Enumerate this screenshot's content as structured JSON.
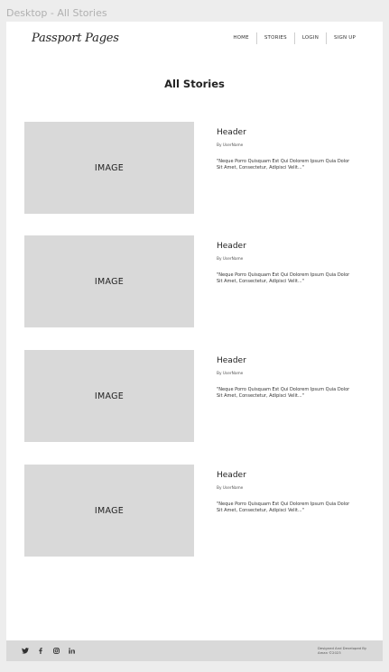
{
  "frame": {
    "label": "Desktop - All Stories"
  },
  "header": {
    "brand": "Passport Pages",
    "nav": [
      {
        "label": "HOME"
      },
      {
        "label": "STORIES"
      },
      {
        "label": "LOGIN"
      },
      {
        "label": "SIGN UP"
      }
    ]
  },
  "main": {
    "title": "All Stories",
    "stories": [
      {
        "image_label": "IMAGE",
        "header": "Header",
        "author": "By UserName",
        "excerpt": "\"Neque Porro Quisquam Est Qui Dolorem Ipsum Quia Dolor Sit Amet, Consectetur, Adipisci Velit...\""
      },
      {
        "image_label": "IMAGE",
        "header": "Header",
        "author": "By UserName",
        "excerpt": "\"Neque Porro Quisquam Est Qui Dolorem Ipsum Quia Dolor Sit Amet, Consectetur, Adipisci Velit...\""
      },
      {
        "image_label": "IMAGE",
        "header": "Header",
        "author": "By UserName",
        "excerpt": "\"Neque Porro Quisquam Est Qui Dolorem Ipsum Quia Dolor Sit Amet, Consectetur, Adipisci Velit...\""
      },
      {
        "image_label": "IMAGE",
        "header": "Header",
        "author": "By UserName",
        "excerpt": "\"Neque Porro Quisquam Est Qui Dolorem Ipsum Quia Dolor Sit Amet, Consectetur, Adipisci Velit...\""
      }
    ]
  },
  "footer": {
    "social_icons": [
      "twitter-icon",
      "facebook-icon",
      "instagram-icon",
      "linkedin-icon"
    ],
    "credit": "Designed And Developed By Aman ©2023"
  },
  "colors": {
    "background": "#ededed",
    "page": "#ffffff",
    "placeholder": "#d9d9d9",
    "footer": "#d9d9d9"
  }
}
